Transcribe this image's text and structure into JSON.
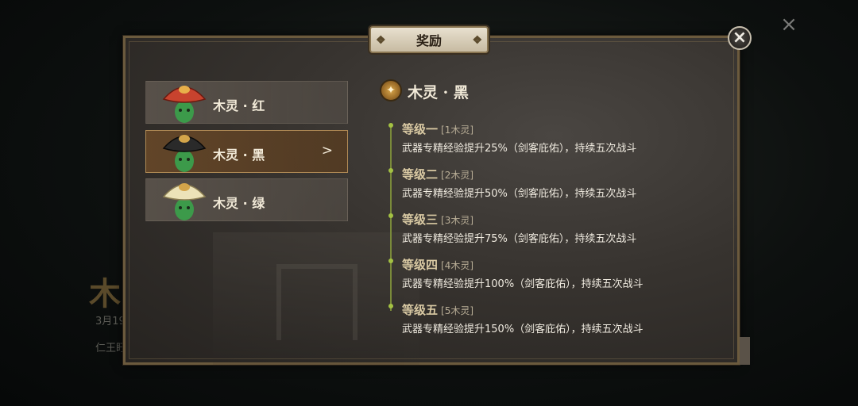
{
  "background": {
    "title_char": "木",
    "date_partial": "3月19",
    "line_partial": "仁王盱"
  },
  "dialog": {
    "title": "奖励",
    "close_symbol": "×",
    "outer_close_symbol": "×"
  },
  "list": {
    "items": [
      {
        "label": "木灵 · 红",
        "hat_color": "#c8432e",
        "selected": false
      },
      {
        "label": "木灵 · 黑",
        "hat_color": "#2a2a2a",
        "selected": true,
        "arrow": ">"
      },
      {
        "label": "木灵 · 绿",
        "hat_color": "#ece3b8",
        "selected": false
      }
    ]
  },
  "detail": {
    "title": "木灵 · 黑",
    "levels": [
      {
        "name": "等级一",
        "req": "[1木灵]",
        "desc": "武器专精经验提升25%（剑客庇佑），持续五次战斗"
      },
      {
        "name": "等级二",
        "req": "[2木灵]",
        "desc": "武器专精经验提升50%（剑客庇佑），持续五次战斗"
      },
      {
        "name": "等级三",
        "req": "[3木灵]",
        "desc": "武器专精经验提升75%（剑客庇佑），持续五次战斗"
      },
      {
        "name": "等级四",
        "req": "[4木灵]",
        "desc": "武器专精经验提升100%（剑客庇佑），持续五次战斗"
      },
      {
        "name": "等级五",
        "req": "[5木灵]",
        "desc": "武器专精经验提升150%（剑客庇佑），持续五次战斗"
      }
    ]
  },
  "colors": {
    "accent_gold": "#b08a55",
    "timeline_green": "#a4c243"
  }
}
